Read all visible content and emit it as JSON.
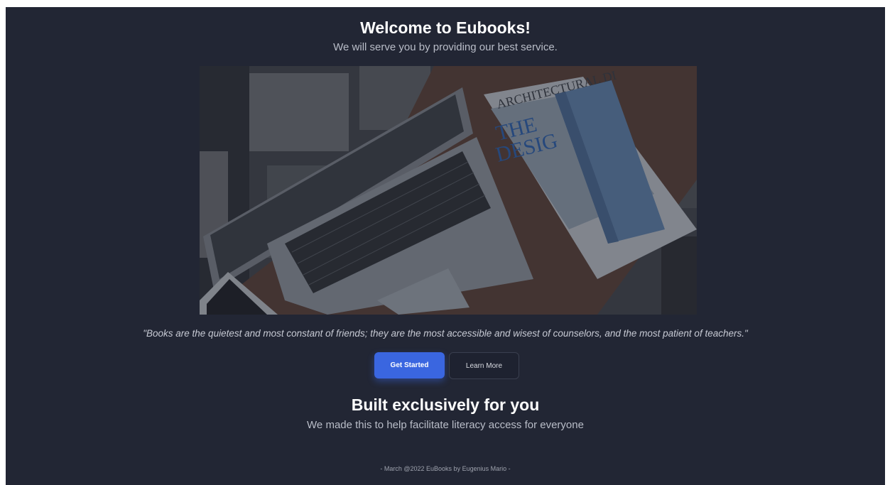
{
  "hero": {
    "title": "Welcome to Eubooks!",
    "subtitle": "We will serve you by providing our best service."
  },
  "image": {
    "magazine_text_1": "ARCHITECTURAL DI",
    "magazine_text_2": "THE",
    "magazine_text_3": "DESIG"
  },
  "quote": "\"Books are the quietest and most constant of friends; they are the most accessible and wisest of counselors, and the most patient of teachers.\"",
  "buttons": {
    "get_started": "Get Started",
    "learn_more": "Learn More"
  },
  "section": {
    "title": "Built exclusively for you",
    "subtitle": "We made this to help facilitate literacy access for everyone"
  },
  "footer": "- March @2022 EuBooks by Eugenius Mario -",
  "colors": {
    "background": "#222634",
    "accent": "#3a66e0"
  }
}
